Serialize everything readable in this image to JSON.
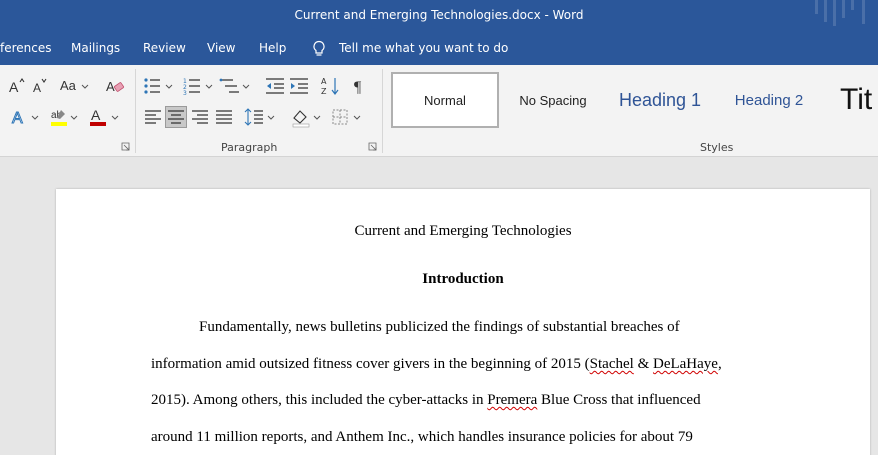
{
  "window": {
    "title": "Current and Emerging Technologies.docx  -  Word"
  },
  "menu": {
    "tabs": [
      "ferences",
      "Mailings",
      "Review",
      "View",
      "Help"
    ],
    "tell_me": "Tell me what you want to do"
  },
  "ribbon": {
    "paragraph_label": "Paragraph",
    "styles_label": "Styles",
    "font_case_label": "Aa",
    "styles": [
      "Normal",
      "No Spacing",
      "Heading 1",
      "Heading 2",
      "Tit"
    ]
  },
  "document": {
    "title": "Current and Emerging Technologies",
    "heading": "Introduction",
    "lines": [
      {
        "parts": [
          "Fundamentally, news bulletins publicized the findings of substantial breaches of"
        ]
      },
      {
        "parts": [
          "information amid outsized fitness cover givers in the beginning of 2015 (",
          "Stachel",
          " & ",
          "DeLaHaye",
          ","
        ]
      },
      {
        "parts": [
          "2015). Among others, this included the cyber-attacks in ",
          "Premera",
          " Blue Cross that influenced"
        ]
      },
      {
        "parts": [
          "around 11 million reports, and Anthem Inc., which handles insurance policies for about 79"
        ]
      }
    ]
  },
  "colors": {
    "title_bar": "#2b579a",
    "ribbon": "#f3f3f3",
    "heading_style": "#2f5496",
    "spell_check": "#d00000"
  }
}
